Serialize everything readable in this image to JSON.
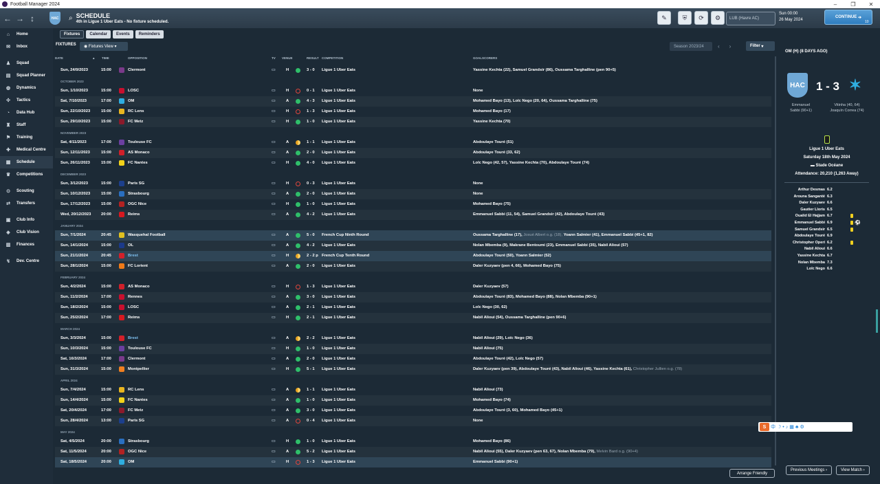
{
  "window": {
    "title": "Football Manager 2024"
  },
  "header": {
    "title": "SCHEDULE",
    "subtitle": "4th in Ligue 1 Uber Eats - No fixture scheduled.",
    "club_abbr": "HAC",
    "search_placeholder": "LUB (Havre AC)",
    "date_line1": "Sun 00:00",
    "date_line2": "26 May 2024",
    "continue_label": "CONTINUE",
    "continue_badge": "10"
  },
  "sidebar": {
    "items": [
      {
        "label": "Home",
        "icon": "home-icon"
      },
      {
        "label": "Inbox",
        "icon": "inbox-icon"
      },
      {
        "label": "Squad",
        "icon": "squad-icon"
      },
      {
        "label": "Squad Planner",
        "icon": "planner-icon"
      },
      {
        "label": "Dynamics",
        "icon": "dynamics-icon"
      },
      {
        "label": "Tactics",
        "icon": "tactics-icon"
      },
      {
        "label": "Data Hub",
        "icon": "datahub-icon"
      },
      {
        "label": "Staff",
        "icon": "staff-icon"
      },
      {
        "label": "Training",
        "icon": "training-icon"
      },
      {
        "label": "Medical Centre",
        "icon": "medical-icon"
      },
      {
        "label": "Schedule",
        "icon": "schedule-icon"
      },
      {
        "label": "Competitions",
        "icon": "trophy-icon"
      },
      {
        "label": "Scouting",
        "icon": "scouting-icon"
      },
      {
        "label": "Transfers",
        "icon": "transfers-icon"
      },
      {
        "label": "Club Info",
        "icon": "info-icon"
      },
      {
        "label": "Club Vision",
        "icon": "vision-icon"
      },
      {
        "label": "Finances",
        "icon": "finances-icon"
      },
      {
        "label": "Dev. Centre",
        "icon": "dev-icon"
      }
    ]
  },
  "tabs": [
    "Fixtures",
    "Calendar",
    "Events",
    "Reminders"
  ],
  "toolbar": {
    "fixtures_label": "FIXTURES",
    "view_label": "Fixtures View",
    "season_label": "Season 2023/24",
    "filter_label": "Filter"
  },
  "columns": {
    "date": "DATE",
    "time": "TIME",
    "opposition": "OPPOSITION",
    "tv": "TV",
    "venue": "VENUE",
    "result": "RESULT",
    "competition": "COMPETITION",
    "goalscorers": "GOALSCORERS"
  },
  "fixtures": [
    {
      "type": "match",
      "date": "Sun, 24/9/2023",
      "time": "15:00",
      "opp": "Clermont",
      "venue": "H",
      "outcome": "win",
      "result": "3 - 0",
      "comp": "Ligue 1 Uber Eats",
      "goals": "Yassine Kechta (22), Samuel Grandsir (86), Oussama Targhalline (pen 90+5)",
      "logo": "#7a3a8a"
    },
    {
      "type": "month",
      "label": "OCTOBER 2023"
    },
    {
      "type": "match",
      "date": "Sun, 1/10/2023",
      "time": "15:00",
      "opp": "LOSC",
      "venue": "H",
      "outcome": "loss",
      "result": "0 - 1",
      "comp": "Ligue 1 Uber Eats",
      "goals": "None",
      "logo": "#c8102e"
    },
    {
      "type": "match",
      "date": "Sat, 7/10/2023",
      "time": "17:00",
      "opp": "OM",
      "venue": "A",
      "outcome": "win",
      "result": "4 - 3",
      "comp": "Ligue 1 Uber Eats",
      "goals": "Mohamed Bayo (13), Loïc Nego (20, 64), Oussama Targhalline (75)",
      "logo": "#2faee0"
    },
    {
      "type": "match",
      "date": "Sun, 22/10/2023",
      "time": "15:00",
      "opp": "RC Lens",
      "venue": "H",
      "outcome": "loss",
      "result": "1 - 3",
      "comp": "Ligue 1 Uber Eats",
      "goals": "Mohamed Bayo (17)",
      "logo": "#e8b520"
    },
    {
      "type": "match",
      "date": "Sun, 29/10/2023",
      "time": "15:00",
      "opp": "FC Metz",
      "venue": "H",
      "outcome": "win",
      "result": "1 - 0",
      "comp": "Ligue 1 Uber Eats",
      "goals": "Yassine Kechta (70)",
      "logo": "#8b1a2b"
    },
    {
      "type": "month",
      "label": "NOVEMBER 2023"
    },
    {
      "type": "match",
      "date": "Sat, 4/11/2023",
      "time": "17:00",
      "opp": "Toulouse FC",
      "venue": "A",
      "outcome": "draw",
      "result": "1 - 1",
      "comp": "Ligue 1 Uber Eats",
      "goals": "Abdoulaye Touré (51)",
      "logo": "#6b3fa0"
    },
    {
      "type": "match",
      "date": "Sun, 12/11/2023",
      "time": "15:00",
      "opp": "AS Monaco",
      "venue": "A",
      "outcome": "win",
      "result": "2 - 0",
      "comp": "Ligue 1 Uber Eats",
      "goals": "Abdoulaye Touré (33, 62)",
      "logo": "#d0202a"
    },
    {
      "type": "match",
      "date": "Sun, 26/11/2023",
      "time": "15:00",
      "opp": "FC Nantes",
      "venue": "H",
      "outcome": "win",
      "result": "4 - 0",
      "comp": "Ligue 1 Uber Eats",
      "goals": "Loïc Nego (42, 57), Yassine Kechta (70), Abdoulaye Touré (74)",
      "logo": "#f2d21a"
    },
    {
      "type": "month",
      "label": "DECEMBER 2023"
    },
    {
      "type": "match",
      "date": "Sun, 3/12/2023",
      "time": "15:00",
      "opp": "Paris SG",
      "venue": "H",
      "outcome": "loss",
      "result": "0 - 3",
      "comp": "Ligue 1 Uber Eats",
      "goals": "None",
      "logo": "#1c3f8c"
    },
    {
      "type": "match",
      "date": "Sun, 10/12/2023",
      "time": "15:00",
      "opp": "Strasbourg",
      "venue": "A",
      "outcome": "win",
      "result": "2 - 0",
      "comp": "Ligue 1 Uber Eats",
      "goals": "None",
      "logo": "#2a6fc0"
    },
    {
      "type": "match",
      "date": "Sun, 17/12/2023",
      "time": "15:00",
      "opp": "OGC Nice",
      "venue": "H",
      "outcome": "win",
      "result": "1 - 0",
      "comp": "Ligue 1 Uber Eats",
      "goals": "Mohamed Bayo (75)",
      "logo": "#b22222"
    },
    {
      "type": "match",
      "date": "Wed, 20/12/2023",
      "time": "20:00",
      "opp": "Reims",
      "venue": "A",
      "outcome": "win",
      "result": "4 - 2",
      "comp": "Ligue 1 Uber Eats",
      "goals": "Emmanuel Sabbi (11, 54), Samuel Grandsir (42), Abdoulaye Touré (43)",
      "logo": "#d71920"
    },
    {
      "type": "month",
      "label": "JANUARY 2024"
    },
    {
      "type": "match",
      "date": "Sun, 7/1/2024",
      "time": "20:45",
      "opp": "Wasquehal Football",
      "venue": "A",
      "outcome": "win",
      "result": "5 - 0",
      "comp": "French Cup Ninth Round",
      "goals": "Oussama Targhalline (17), ",
      "goals_grey": "Josué Albert o.g. (18), ",
      "goals_tail": "Yoann Salmier (41), Emmanuel Sabbi (45+1, 82)",
      "logo": "#e0c020",
      "hl": true
    },
    {
      "type": "match",
      "date": "Sun, 14/1/2024",
      "time": "15:00",
      "opp": "OL",
      "venue": "A",
      "outcome": "win",
      "result": "4 - 2",
      "comp": "Ligue 1 Uber Eats",
      "goals": "Nolan Mbemba (9), Makrane Bentoumi (23), Emmanuel Sabbi (35), Nabil Alioui (57)",
      "logo": "#1b3a8a"
    },
    {
      "type": "match",
      "date": "Sun, 21/1/2024",
      "time": "20:45",
      "opp": "Brest",
      "venue": "H",
      "outcome": "draw",
      "result": "2 - 2 p",
      "comp": "French Cup Tenth Round",
      "goals": "Abdoulaye Touré (50), Yoann Salmier (52)",
      "logo": "#d3202a",
      "blue": true,
      "hl": true
    },
    {
      "type": "match",
      "date": "Sun, 28/1/2024",
      "time": "15:00",
      "opp": "FC Lorient",
      "venue": "A",
      "outcome": "win",
      "result": "2 - 0",
      "comp": "Ligue 1 Uber Eats",
      "goals": "Daler Kuzyaev (pen 4, 66), Mohamed Bayo (75)",
      "logo": "#f07a18"
    },
    {
      "type": "month",
      "label": "FEBRUARY 2024"
    },
    {
      "type": "match",
      "date": "Sun, 4/2/2024",
      "time": "15:00",
      "opp": "AS Monaco",
      "venue": "H",
      "outcome": "loss",
      "result": "1 - 3",
      "comp": "Ligue 1 Uber Eats",
      "goals": "Daler Kuzyaev (57)",
      "logo": "#d0202a"
    },
    {
      "type": "match",
      "date": "Sun, 11/2/2024",
      "time": "17:00",
      "opp": "Rennes",
      "venue": "A",
      "outcome": "win",
      "result": "3 - 0",
      "comp": "Ligue 1 Uber Eats",
      "goals": "Abdoulaye Touré (83), Mohamed Bayo (88), Nolan Mbemba (90+1)",
      "logo": "#c8102e"
    },
    {
      "type": "match",
      "date": "Sun, 18/2/2024",
      "time": "15:00",
      "opp": "LOSC",
      "venue": "A",
      "outcome": "win",
      "result": "2 - 1",
      "comp": "Ligue 1 Uber Eats",
      "goals": "Loïc Nego (30, 62)",
      "logo": "#c8102e"
    },
    {
      "type": "match",
      "date": "Sun, 25/2/2024",
      "time": "17:00",
      "opp": "Reims",
      "venue": "H",
      "outcome": "win",
      "result": "2 - 1",
      "comp": "Ligue 1 Uber Eats",
      "goals": "Nabil Alioui (54), Oussama Targhalline (pen 90+6)",
      "logo": "#d71920"
    },
    {
      "type": "month",
      "label": "MARCH 2024"
    },
    {
      "type": "match",
      "date": "Sun, 3/3/2024",
      "time": "15:00",
      "opp": "Brest",
      "venue": "A",
      "outcome": "draw",
      "result": "2 - 2",
      "comp": "Ligue 1 Uber Eats",
      "goals": "Nabil Alioui (29), Loïc Nego (36)",
      "logo": "#d3202a",
      "blue": true
    },
    {
      "type": "match",
      "date": "Sun, 10/3/2024",
      "time": "15:00",
      "opp": "Toulouse FC",
      "venue": "H",
      "outcome": "win",
      "result": "1 - 0",
      "comp": "Ligue 1 Uber Eats",
      "goals": "Nabil Alioui (75)",
      "logo": "#6b3fa0"
    },
    {
      "type": "match",
      "date": "Sat, 16/3/2024",
      "time": "17:00",
      "opp": "Clermont",
      "venue": "A",
      "outcome": "win",
      "result": "2 - 0",
      "comp": "Ligue 1 Uber Eats",
      "goals": "Abdoulaye Touré (42), Loïc Nego (57)",
      "logo": "#7a3a8a"
    },
    {
      "type": "match",
      "date": "Sun, 31/3/2024",
      "time": "15:00",
      "opp": "Montpellier",
      "venue": "H",
      "outcome": "win",
      "result": "5 - 1",
      "comp": "Ligue 1 Uber Eats",
      "goals": "Daler Kuzyaev (pen 39), Abdoulaye Touré (43), Nabil Alioui (46), Yassine Kechta (61), ",
      "goals_grey": "Christopher Jullien o.g. (78)",
      "logo": "#f08020"
    },
    {
      "type": "month",
      "label": "APRIL 2024"
    },
    {
      "type": "match",
      "date": "Sun, 7/4/2024",
      "time": "15:00",
      "opp": "RC Lens",
      "venue": "A",
      "outcome": "draw",
      "result": "1 - 1",
      "comp": "Ligue 1 Uber Eats",
      "goals": "Nabil Alioui (73)",
      "logo": "#e8b520"
    },
    {
      "type": "match",
      "date": "Sun, 14/4/2024",
      "time": "15:00",
      "opp": "FC Nantes",
      "venue": "A",
      "outcome": "win",
      "result": "1 - 0",
      "comp": "Ligue 1 Uber Eats",
      "goals": "Mohamed Bayo (74)",
      "logo": "#f2d21a"
    },
    {
      "type": "match",
      "date": "Sat, 20/4/2024",
      "time": "17:00",
      "opp": "FC Metz",
      "venue": "A",
      "outcome": "win",
      "result": "3 - 0",
      "comp": "Ligue 1 Uber Eats",
      "goals": "Abdoulaye Touré (3, 60), Mohamed Bayo (45+1)",
      "logo": "#8b1a2b"
    },
    {
      "type": "match",
      "date": "Sun, 28/4/2024",
      "time": "13:00",
      "opp": "Paris SG",
      "venue": "A",
      "outcome": "loss",
      "result": "0 - 4",
      "comp": "Ligue 1 Uber Eats",
      "goals": "None",
      "logo": "#1c3f8c"
    },
    {
      "type": "month",
      "label": "MAY 2024"
    },
    {
      "type": "match",
      "date": "Sat, 4/5/2024",
      "time": "20:00",
      "opp": "Strasbourg",
      "venue": "H",
      "outcome": "win",
      "result": "1 - 0",
      "comp": "Ligue 1 Uber Eats",
      "goals": "Mohamed Bayo (86)",
      "logo": "#2a6fc0"
    },
    {
      "type": "match",
      "date": "Sat, 11/5/2024",
      "time": "20:00",
      "opp": "OGC Nice",
      "venue": "A",
      "outcome": "win",
      "result": "5 - 2",
      "comp": "Ligue 1 Uber Eats",
      "goals": "Nabil Alioui (55), Daler Kuzyaev (pen 63, 67), Nolan Mbemba (79), ",
      "goals_grey": "Melvin Bard o.g. (90+4)",
      "logo": "#b22222"
    },
    {
      "type": "match",
      "date": "Sat, 18/5/2024",
      "time": "20:00",
      "opp": "OM",
      "venue": "H",
      "outcome": "loss",
      "result": "1 - 3",
      "comp": "Ligue 1 Uber Eats",
      "goals": "Emmanuel Sabbi (90+1)",
      "logo": "#2faee0",
      "hl": true
    }
  ],
  "arrange_label": "Arrange Friendly",
  "match_panel": {
    "heading": "OM (H) (8 DAYS AGO)",
    "home_abbr": "HAC",
    "score": "1 - 3",
    "home_scorers": "Emmanuel Sabbi (90+1)",
    "away_scorers": "Vitinha (40, 64) Joaquín Correa (74)",
    "competition": "Ligue 1 Uber Eats",
    "date": "Saturday 18th May 2024",
    "stadium": "Stade Océane",
    "attendance": "Attendance: 20,210 (1,263 Away)",
    "ratings": [
      {
        "name": "Arthur Desmas",
        "rating": "6.2"
      },
      {
        "name": "Arouna Sanganté",
        "rating": "6.3"
      },
      {
        "name": "Daler Kuzyaev",
        "rating": "6.6"
      },
      {
        "name": "Gautier Lloris",
        "rating": "6.5"
      },
      {
        "name": "Oualid El Hajjam",
        "rating": "6.7",
        "card": true
      },
      {
        "name": "Emmanuel Sabbi",
        "rating": "6.9",
        "card": true,
        "goal": true
      },
      {
        "name": "Samuel Grandsir",
        "rating": "6.5",
        "card": true
      },
      {
        "name": "Abdoulaye Touré",
        "rating": "6.9"
      },
      {
        "name": "Christopher Operi",
        "rating": "6.2",
        "card": true
      },
      {
        "name": "Nabil Alioui",
        "rating": "6.6"
      },
      {
        "name": "Yassine Kechta",
        "rating": "6.7"
      },
      {
        "name": "Nolan Mbemba",
        "rating": "7.3"
      },
      {
        "name": "Loïc Nego",
        "rating": "6.6"
      }
    ],
    "prev_label": "Previous Meetings",
    "view_label": "View Match"
  }
}
